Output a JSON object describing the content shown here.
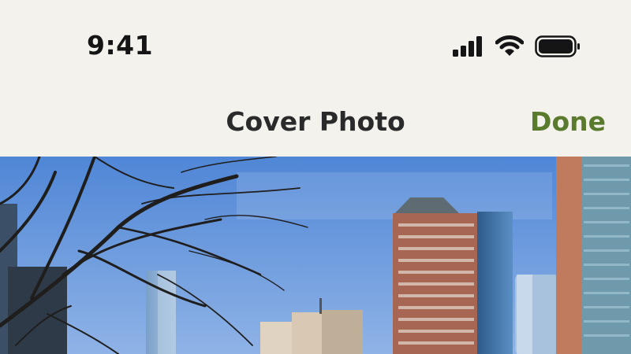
{
  "status_bar": {
    "time": "9:41",
    "signal_icon": "cellular-signal-icon",
    "wifi_icon": "wifi-icon",
    "battery_icon": "battery-icon",
    "battery_level": 1.0
  },
  "nav": {
    "title": "Cover Photo",
    "done_label": "Done"
  },
  "colors": {
    "background": "#f3f2ec",
    "accent": "#5a7a2e",
    "text": "#2a2a2a"
  }
}
